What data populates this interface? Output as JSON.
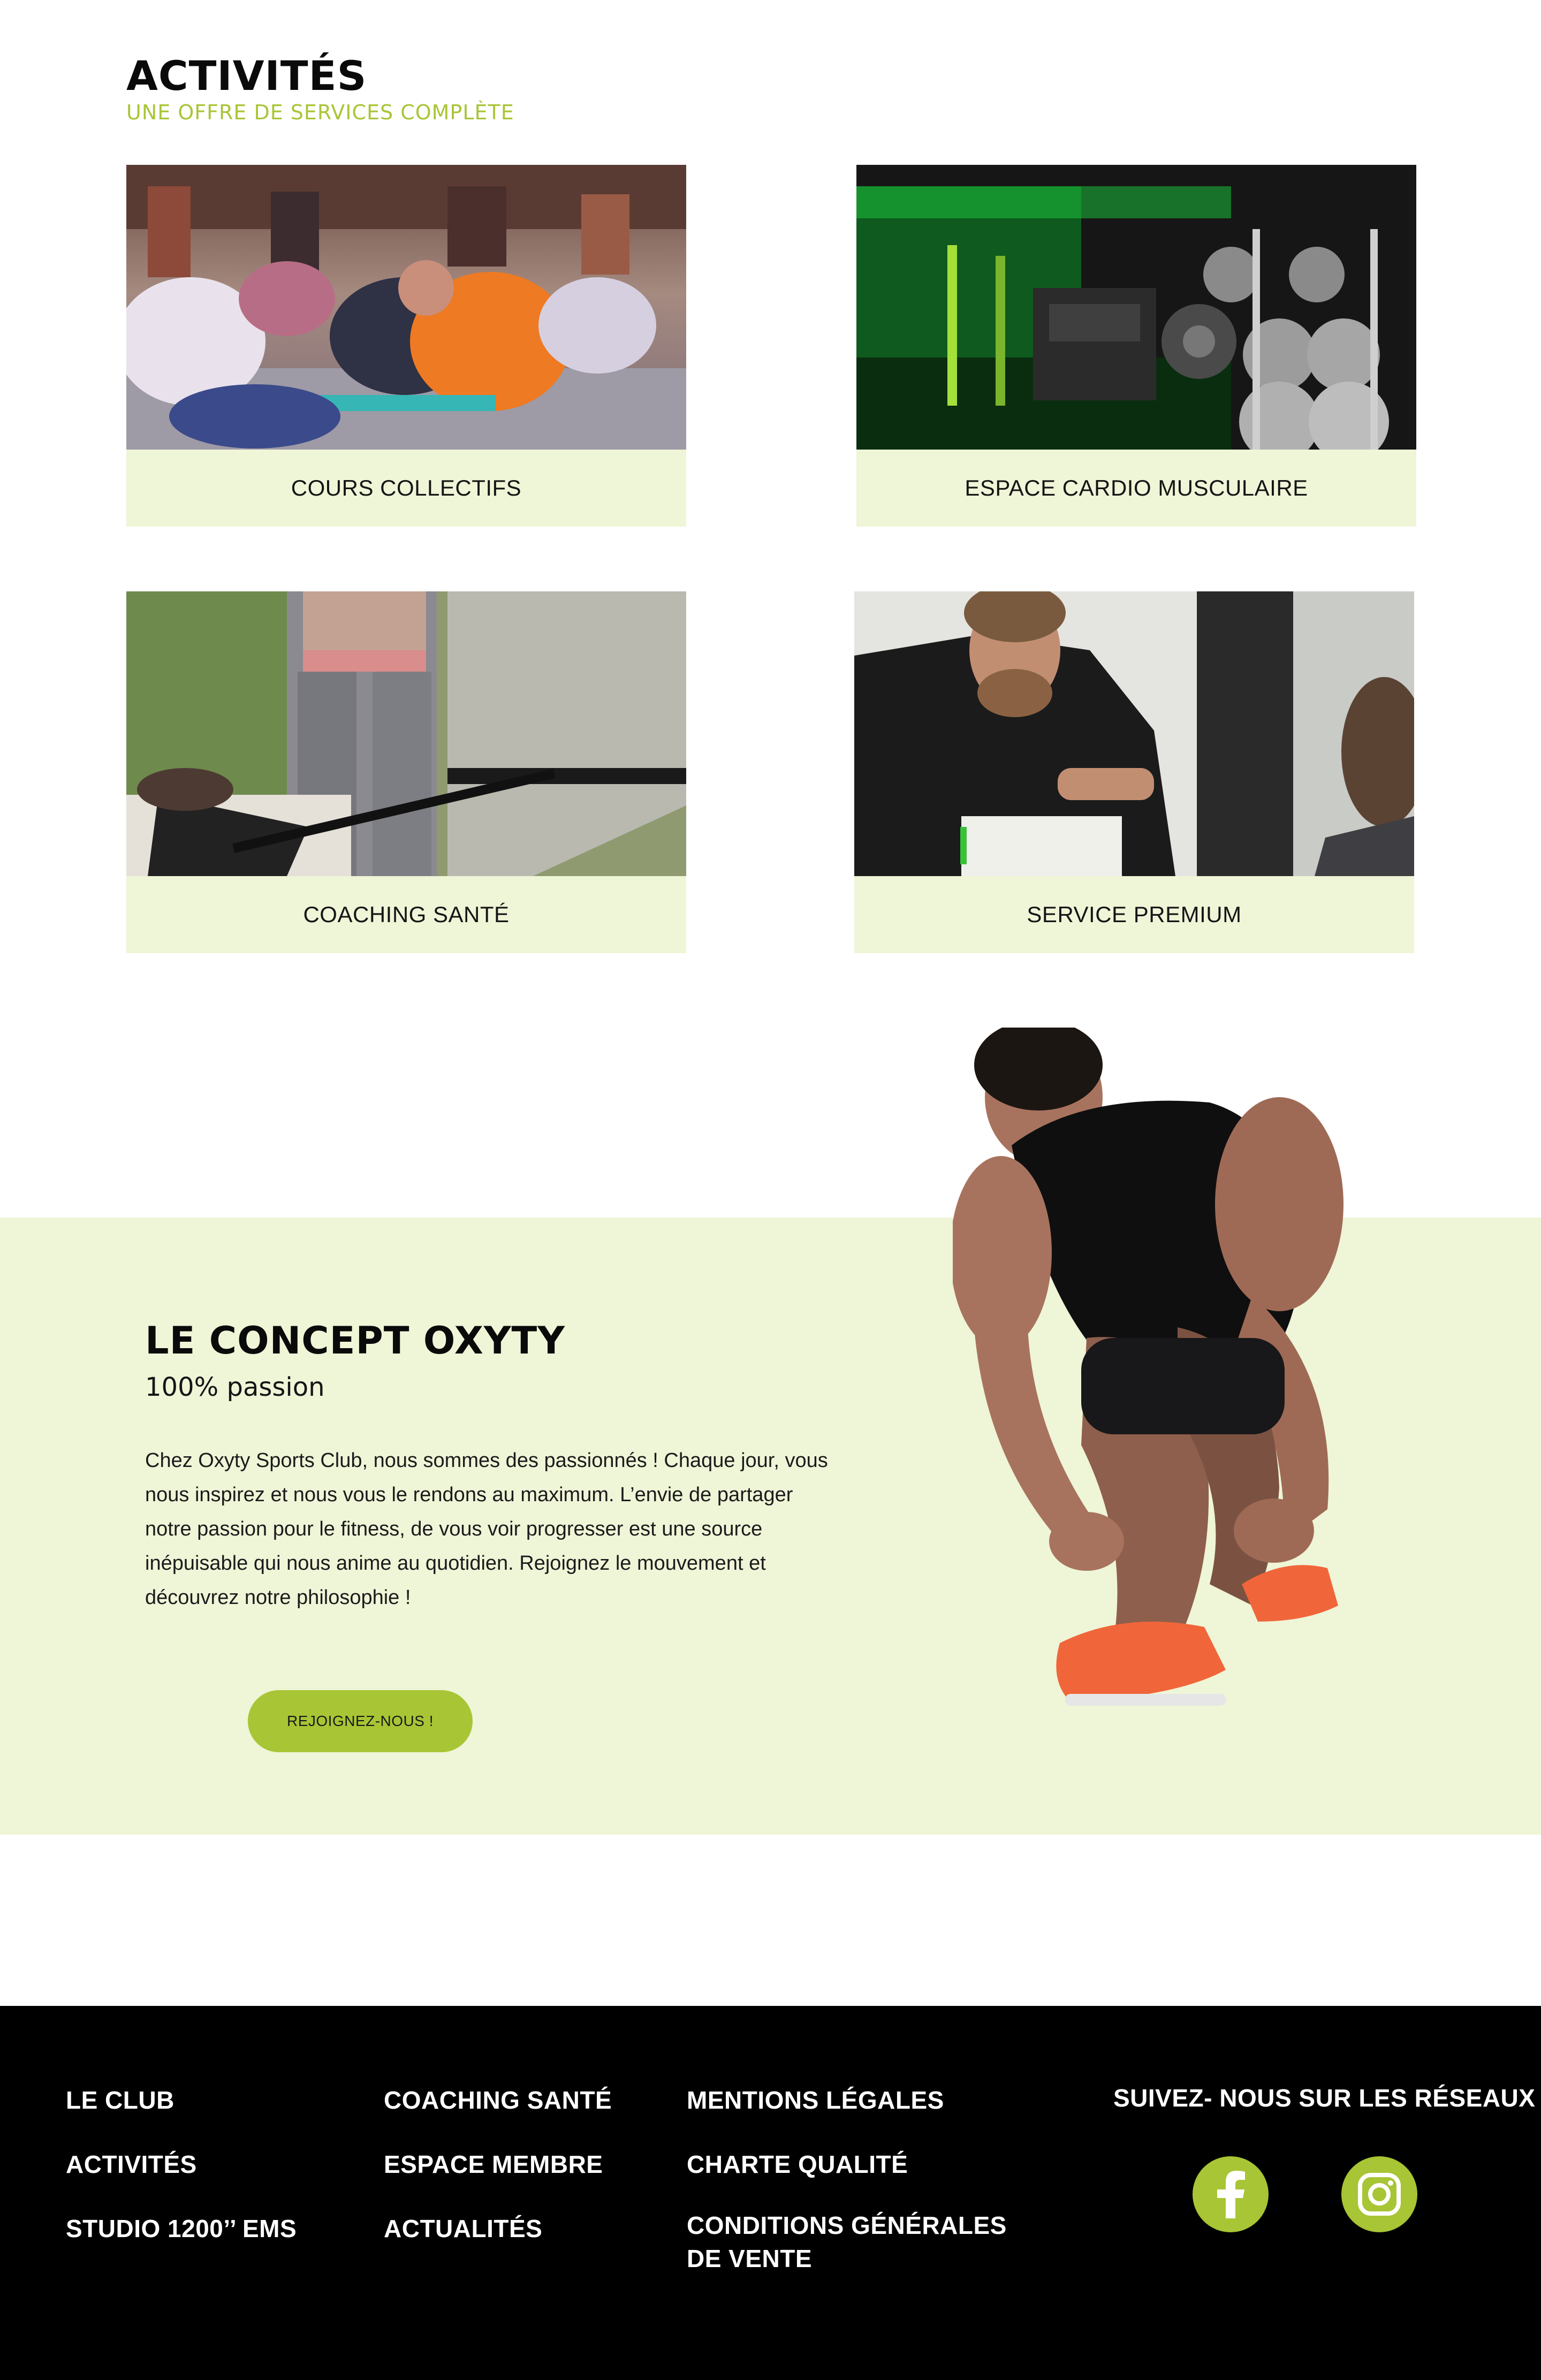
{
  "activities": {
    "title": "ACTIVITÉS",
    "subtitle": "UNE OFFRE DE SERVICES COMPLÈTE",
    "cards": [
      {
        "label": "COURS COLLECTIFS"
      },
      {
        "label": "ESPACE CARDIO MUSCULAIRE"
      },
      {
        "label": "COACHING SANTÉ"
      },
      {
        "label": "SERVICE PREMIUM"
      }
    ]
  },
  "concept": {
    "title": "LE CONCEPT OXYTY",
    "subtitle": "100% passion",
    "body": "Chez Oxyty Sports Club, nous sommes des passionnés ! Chaque jour, vous nous inspirez et nous vous le rendons au maximum. L’envie de partager notre passion pour le fitness, de vous voir progresser est une source inépuisable qui nous anime au quotidien. Rejoignez le mouvement et découvrez notre philosophie !",
    "cta_label": "REJOIGNEZ-NOUS !"
  },
  "footer": {
    "col1": [
      "LE CLUB",
      "ACTIVITÉS",
      "STUDIO 1200’’ EMS"
    ],
    "col2": [
      "COACHING SANTÉ",
      "ESPACE MEMBRE",
      "ACTUALITÉS"
    ],
    "col3": [
      "MENTIONS LÉGALES",
      "CHARTE QUALITÉ",
      "CONDITIONS GÉNÉRALES DE VENTE"
    ],
    "social_title": "SUIVEZ- NOUS SUR LES RÉSEAUX",
    "social_icons": [
      "facebook-icon",
      "instagram-icon"
    ]
  },
  "colors": {
    "accent": "#a8c535",
    "light_band": "#eff5d7",
    "footer_bg": "#000000"
  }
}
